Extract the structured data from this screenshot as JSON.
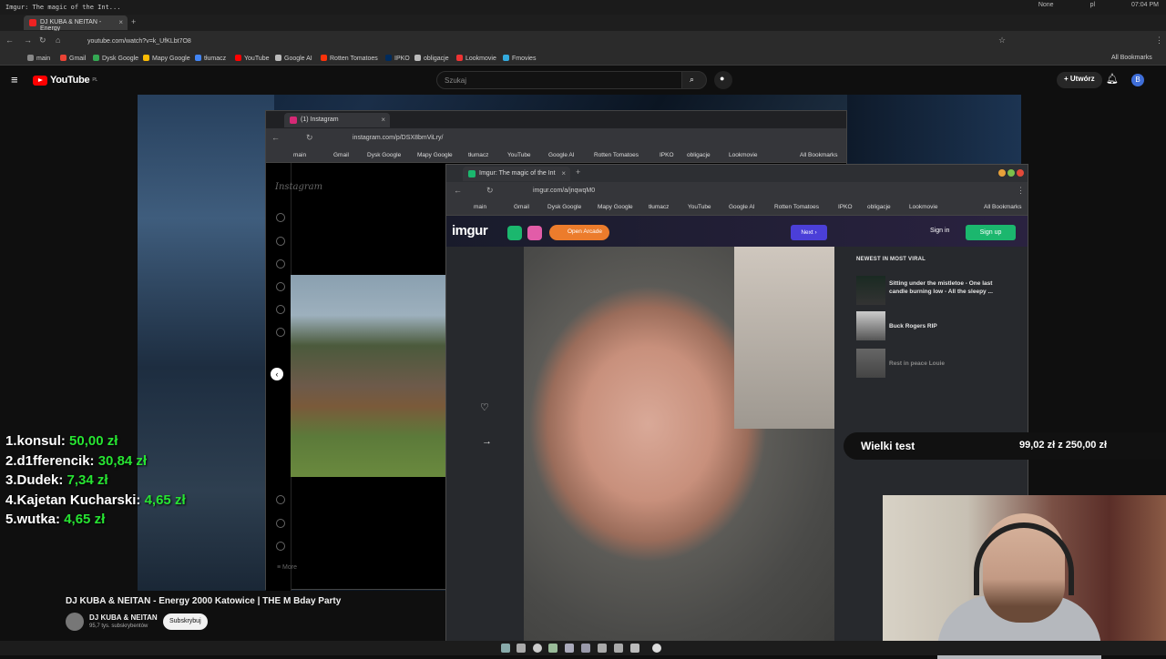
{
  "system": {
    "title": "Imgur: The magic of the Int...",
    "right_items": [
      "None",
      "pl",
      "07:04 PM"
    ]
  },
  "browser": {
    "tab_title": "DJ KUBA & NEITAN - Energy",
    "url": "youtube.com/watch?v=k_UfKLbt7O8",
    "bookmarks": [
      "main",
      "Gmail",
      "Dysk Google",
      "Mapy Google",
      "tłumacz",
      "YouTube",
      "Google AI",
      "Rotten Tomatoes",
      "IPKO",
      "obligacje",
      "Lookmovie",
      "Fmovies"
    ],
    "all_bookmarks": "All Bookmarks"
  },
  "youtube": {
    "logo": "YouTube",
    "logo_region": "PL",
    "search_placeholder": "Szukaj",
    "create_label": "Utwórz",
    "avatar_letter": "B",
    "video_title": "DJ KUBA & NEITAN - Energy 2000 Katowice | THE M Bday Party",
    "channel_name": "DJ KUBA & NEITAN",
    "subscribers": "95,7 tys. subskrybentów",
    "subscribe_label": "Subskrybuj"
  },
  "leaderboard": [
    {
      "rank": "1.",
      "name": "konsul:",
      "amount": "50,00 zł"
    },
    {
      "rank": "2.",
      "name": "d1fferencik:",
      "amount": "30,84 zł"
    },
    {
      "rank": "3.",
      "name": "Dudek:",
      "amount": "7,34 zł"
    },
    {
      "rank": "4.",
      "name": "Kajetan Kucharski:",
      "amount": "4,65 zł"
    },
    {
      "rank": "5.",
      "name": "wutka:",
      "amount": "4,65 zł"
    }
  ],
  "goal": {
    "name": "Wielki test",
    "value": "99,02 zł z 250,00 zł"
  },
  "instagram": {
    "tab_title": "(1) Instagram",
    "url": "instagram.com/p/DSX8bmViLry/",
    "bookmarks": [
      "main",
      "Gmail",
      "Dysk Google",
      "Mapy Google",
      "tłumacz",
      "YouTube",
      "Google AI",
      "Rotten Tomatoes",
      "IPKO",
      "obligacje",
      "Lookmovie"
    ],
    "all_bookmarks": "All Bookmarks",
    "logo": "Instagram",
    "more_label": "More"
  },
  "imgur": {
    "tab_title": "Imgur: The magic of the Int",
    "url": "imgur.com/a/jnqwqM0",
    "bookmarks": [
      "main",
      "Gmail",
      "Dysk Google",
      "Mapy Google",
      "tłumacz",
      "YouTube",
      "Google AI",
      "Rotten Tomatoes",
      "IPKO",
      "obligacje",
      "Lookmovie"
    ],
    "all_bookmarks": "All Bookmarks",
    "logo": "imgur",
    "arcade_label": "Open Arcade",
    "next_label": "Next",
    "sign_in": "Sign in",
    "sign_up": "Sign up",
    "newest_heading": "NEWEST IN MOST VIRAL",
    "viral_items": [
      "Sitting under the mistletoe - One last candle burning low - All the sleepy ...",
      "Buck Rogers RIP",
      "Rest in peace Louie"
    ]
  }
}
